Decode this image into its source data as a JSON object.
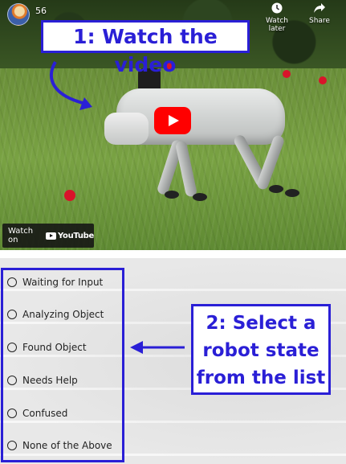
{
  "video": {
    "title_count": "56",
    "watch_later_label": "Watch later",
    "share_label": "Share",
    "watch_on_label": "Watch on",
    "youtube_label": "YouTube"
  },
  "callouts": {
    "step1": "1: Watch the video",
    "step2_lines": [
      "2: Select a",
      "robot state",
      "from the list"
    ]
  },
  "options": [
    {
      "label": "Waiting for Input",
      "selected": false
    },
    {
      "label": "Analyzing Object",
      "selected": false
    },
    {
      "label": "Found Object",
      "selected": false
    },
    {
      "label": "Needs Help",
      "selected": false
    },
    {
      "label": "Confused",
      "selected": false
    },
    {
      "label": "None of the Above",
      "selected": false
    }
  ],
  "colors": {
    "callout_blue": "#2a1fd6",
    "play_red": "#ff0000"
  }
}
